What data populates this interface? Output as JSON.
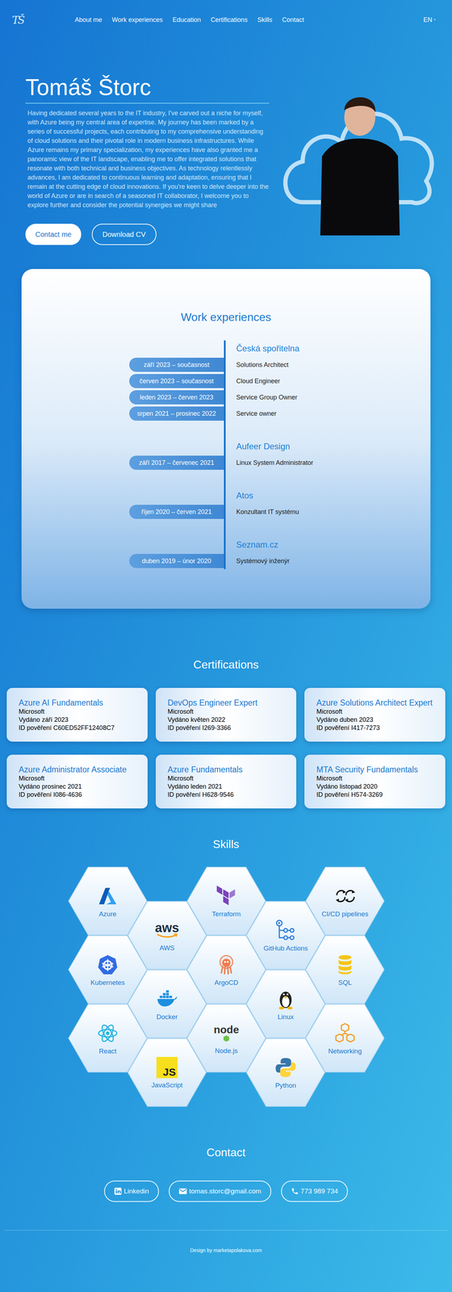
{
  "nav": {
    "logo": "TŠ",
    "items": [
      "About me",
      "Work experiences",
      "Education",
      "Certifications",
      "Skills",
      "Contact"
    ],
    "language": "EN",
    "caret": "⌄"
  },
  "hero": {
    "name": "Tomáš Štorc",
    "text": "Having dedicated several years to the IT industry, I've carved out a niche for myself, with Azure being my central area of expertise. My journey has been marked by a series of successful projects, each contributing to my comprehensive understanding of cloud solutions and their pivotal role in modern business infrastructures. While Azure remains my primary specialization, my experiences have also granted me a panoramic view of the IT landscape, enabling me to offer integrated solutions that resonate with both technical and business objectives. As technology relentlessly advances, I am dedicated to continuous learning and adaptation, ensuring that I remain at the cutting edge of cloud innovations. If you're keen to delve deeper into the world of Azure or are in search of a seasoned IT collaborator, I welcome you to explore further and consider the potential synergies we might share",
    "buttons": [
      "Contact me",
      "Download CV"
    ]
  },
  "experience": {
    "title": "Work experiences",
    "groups": [
      {
        "company": "Česká spořitelna",
        "roles": [
          {
            "period": "září 2023 – současnost",
            "title": "Solutions Architect"
          },
          {
            "period": "červen 2023 – současnost",
            "title": "Cloud Engineer"
          },
          {
            "period": "leden 2023 – červen 2023",
            "title": "Service Group Owner"
          },
          {
            "period": "srpen 2021 – prosinec 2022",
            "title": "Service owner"
          }
        ]
      },
      {
        "company": "Aufeer Design",
        "roles": [
          {
            "period": "září 2017 – červenec 2021",
            "title": "Linux System Administrator"
          }
        ]
      },
      {
        "company": "Atos",
        "roles": [
          {
            "period": "říjen 2020 – červen 2021",
            "title": "Konzultant IT systému"
          }
        ]
      },
      {
        "company": "Seznam.cz",
        "roles": [
          {
            "period": "duben 2019 – únor 2020",
            "title": "Systémový inženýr"
          }
        ]
      }
    ]
  },
  "certifications": {
    "title": "Certifications",
    "items": [
      {
        "name": "Azure AI Fundamentals",
        "issuer": "Microsoft",
        "issued": "Vydáno září 2023",
        "id": "ID pověření C60ED52FF12408C7"
      },
      {
        "name": "DevOps Engineer Expert",
        "issuer": "Microsoft",
        "issued": "Vydáno květen 2022",
        "id": "ID pověření I269-3366"
      },
      {
        "name": "Azure Solutions Architect Expert",
        "issuer": "Microsoft",
        "issued": "Vydáno duben 2023",
        "id": "ID pověření I417-7273"
      },
      {
        "name": "Azure Administrator Associate",
        "issuer": "Microsoft",
        "issued": "Vydáno prosinec 2021",
        "id": "ID pověření I086-4636"
      },
      {
        "name": "Azure Fundamentals",
        "issuer": "Microsoft",
        "issued": "Vydáno leden 2021",
        "id": "ID pověření H628-9546"
      },
      {
        "name": "MTA Security Fundamentals",
        "issuer": "Microsoft",
        "issued": "Vydáno listopad 2020",
        "id": "ID pověření H574-3269"
      }
    ]
  },
  "skills": {
    "title": "Skills",
    "items": [
      {
        "label": "Azure"
      },
      {
        "label": "Kubernetes"
      },
      {
        "label": "React"
      },
      {
        "label": "AWS",
        "mark": "aws"
      },
      {
        "label": "Docker"
      },
      {
        "label": "JavaScript",
        "mark": "JS"
      },
      {
        "label": "Terraform"
      },
      {
        "label": "ArgoCD"
      },
      {
        "label": "Node.js",
        "mark": "node"
      },
      {
        "label": "GitHub Actions"
      },
      {
        "label": "Linux"
      },
      {
        "label": "Python"
      },
      {
        "label": "CI/CD pipelines"
      },
      {
        "label": "SQL"
      },
      {
        "label": "Networking"
      }
    ]
  },
  "contact": {
    "title": "Contact",
    "links": [
      "Linkedin",
      "tomas.storc@gmail.com",
      "773 989 734"
    ]
  },
  "footer": {
    "text": "Design by marketapolakova.com"
  }
}
